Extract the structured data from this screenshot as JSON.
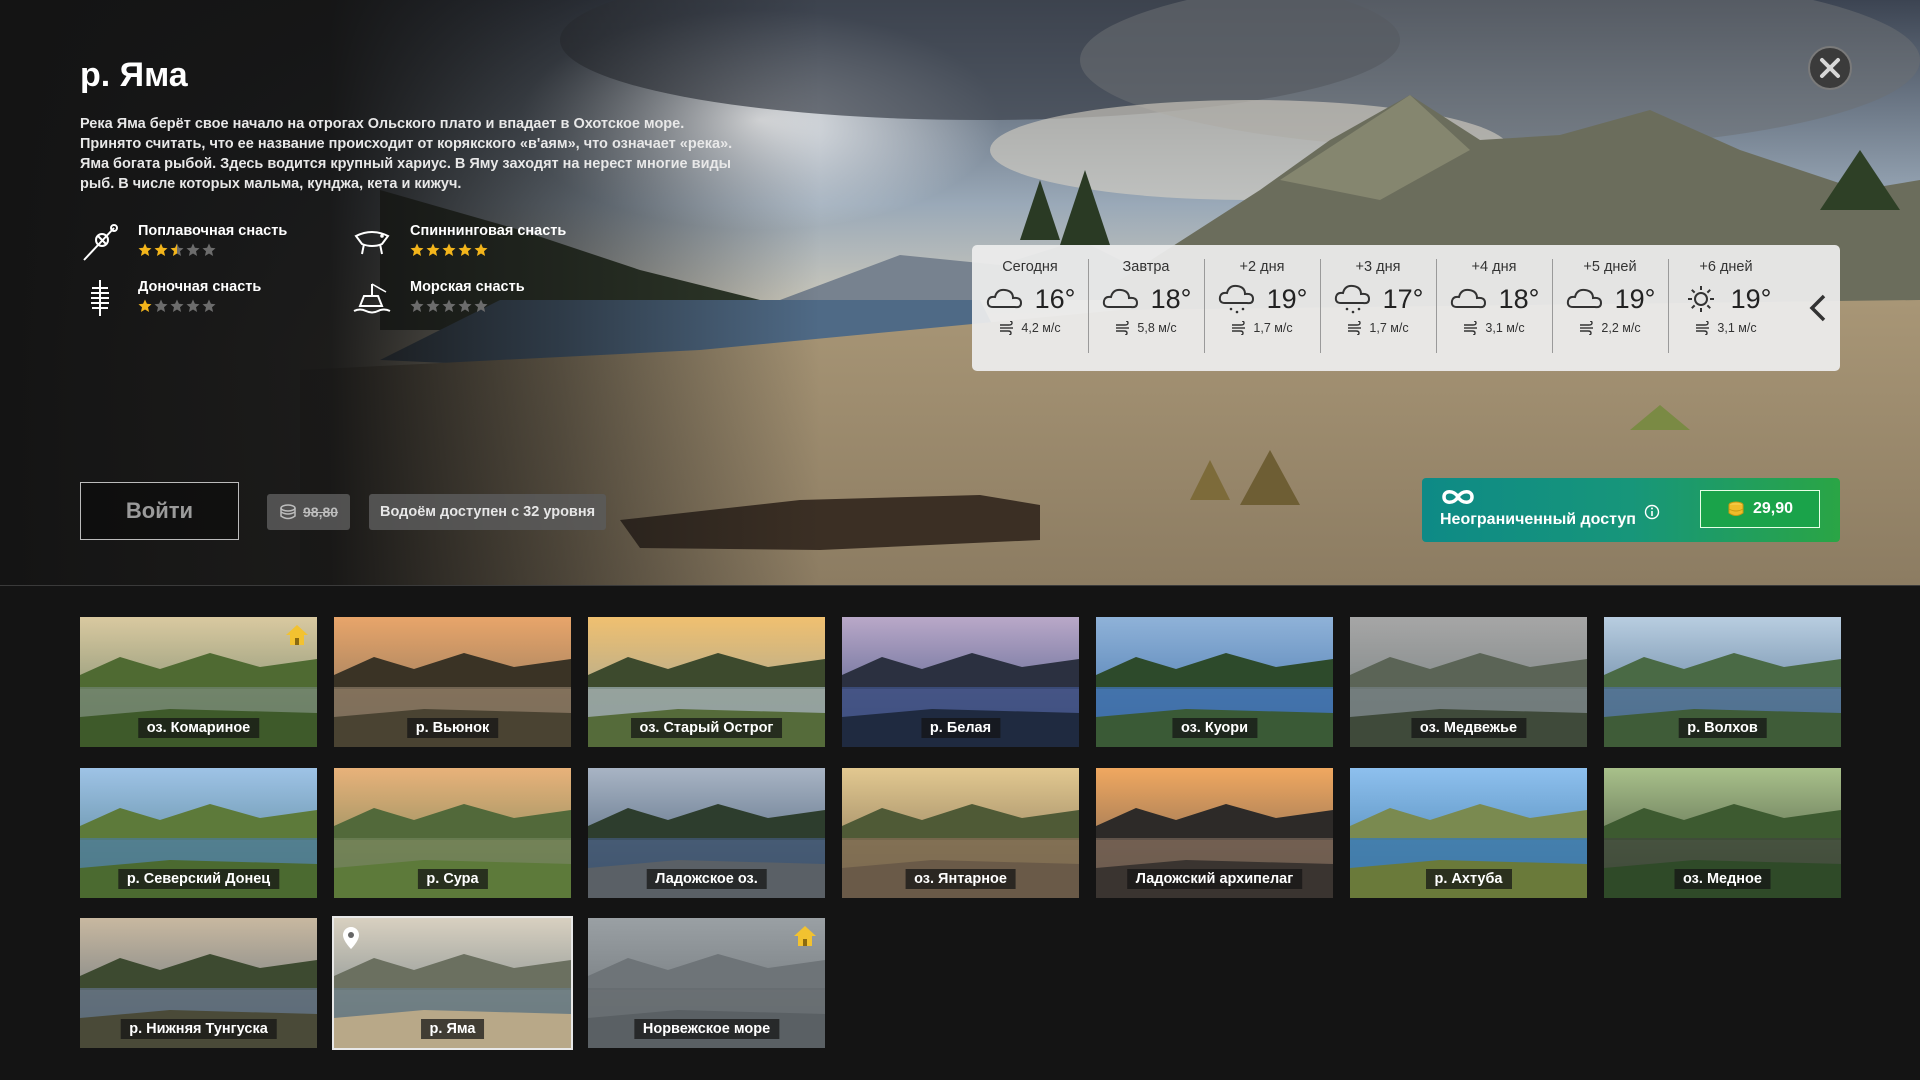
{
  "location": {
    "title": "р. Яма",
    "description": "Река Яма берёт свое начало на отрогах Ольского плато и впадает в Охотское море. Принято считать, что ее название происходит от корякского «в'аям», что означает «река». Яма богата рыбой. Здесь водится крупный хариус. В Яму заходят на нерест многие виды рыб. В числе которых мальма, кунджа, кета и кижуч."
  },
  "gear": [
    {
      "name": "Поплавочная снасть",
      "icon": "float-rod-icon",
      "rating": 2.5
    },
    {
      "name": "Спиннинговая снасть",
      "icon": "spinning-lure-icon",
      "rating": 5
    },
    {
      "name": "Доночная снасть",
      "icon": "feeder-icon",
      "rating": 1
    },
    {
      "name": "Морская снасть",
      "icon": "sea-fishing-icon",
      "rating": 0
    }
  ],
  "actions": {
    "enter_label": "Войти",
    "old_price": "98,80",
    "level_note": "Водоём доступен с 32 уровня"
  },
  "weather": [
    {
      "label": "Сегодня",
      "temp": "16°",
      "wind": "4,2 м/с",
      "icon": "cloud-icon"
    },
    {
      "label": "Завтра",
      "temp": "18°",
      "wind": "5,8 м/с",
      "icon": "cloud-icon"
    },
    {
      "label": "+2 дня",
      "temp": "19°",
      "wind": "1,7 м/с",
      "icon": "cloud-rain-icon"
    },
    {
      "label": "+3 дня",
      "temp": "17°",
      "wind": "1,7 м/с",
      "icon": "cloud-rain-icon"
    },
    {
      "label": "+4 дня",
      "temp": "18°",
      "wind": "3,1 м/с",
      "icon": "cloud-icon"
    },
    {
      "label": "+5 дней",
      "temp": "19°",
      "wind": "2,2 м/с",
      "icon": "cloud-icon"
    },
    {
      "label": "+6 дней",
      "temp": "19°",
      "wind": "3,1 м/с",
      "icon": "sun-icon"
    }
  ],
  "unlimited": {
    "label": "Неограниченный доступ",
    "price": "29,90"
  },
  "locations": [
    {
      "name": "оз. Комариное",
      "home": true,
      "sky": "#d9c9a0",
      "hill": "#4f6a32",
      "ground": "#3e5a2a",
      "water": "#6a7f66"
    },
    {
      "name": "р. Вьюнок",
      "sky": "#e8a56a",
      "hill": "#3a3325",
      "ground": "#4a4332",
      "water": "#7b6d5a"
    },
    {
      "name": "оз. Старый Острог",
      "sky": "#f0c070",
      "hill": "#3d4a2d",
      "ground": "#556b3a",
      "water": "#8fa0a0"
    },
    {
      "name": "р. Белая",
      "sky": "#b9a8c8",
      "hill": "#2b3040",
      "ground": "#1f2a40",
      "water": "#3d4f80"
    },
    {
      "name": "оз. Куори",
      "sky": "#8fb2d8",
      "hill": "#2d4a2b",
      "ground": "#3a5a36",
      "water": "#3e6fa8"
    },
    {
      "name": "оз. Медвежье",
      "sky": "#a6a6a6",
      "hill": "#5b6456",
      "ground": "#3f4a3a",
      "water": "#707a7a"
    },
    {
      "name": "р. Волхов",
      "sky": "#b8cde0",
      "hill": "#4a6a45",
      "ground": "#3f5c38",
      "water": "#4d6e8e"
    },
    {
      "name": "р. Северский Донец",
      "sky": "#9ec3e6",
      "hill": "#5d7a3a",
      "ground": "#4b6a30",
      "water": "#4d7a8a"
    },
    {
      "name": "р. Сура",
      "sky": "#e8b27a",
      "hill": "#52693a",
      "ground": "#5d7a3a",
      "water": "#6b7f55"
    },
    {
      "name": "Ладожское оз.",
      "sky": "#a8b4c4",
      "hill": "#2d3d2d",
      "ground": "#5a6066",
      "water": "#3f556e"
    },
    {
      "name": "оз. Янтарное",
      "sky": "#e2c890",
      "hill": "#4f5a36",
      "ground": "#6a5a48",
      "water": "#7b6a50"
    },
    {
      "name": "Ладожский архипелаг",
      "sky": "#f0a860",
      "hill": "#2d2a28",
      "ground": "#3a3430",
      "water": "#6a5a50"
    },
    {
      "name": "р. Ахтуба",
      "sky": "#8ec0ee",
      "hill": "#7a8a50",
      "ground": "#6a7a3a",
      "water": "#3f7aa8"
    },
    {
      "name": "оз. Медное",
      "sky": "#a8c08a",
      "hill": "#3d5a30",
      "ground": "#2f4a28",
      "water": "#3f4a3a"
    },
    {
      "name": "р. Нижняя Тунгуска",
      "sky": "#c8b8a0",
      "hill": "#3d4a30",
      "ground": "#4a4a38",
      "water": "#5a6a78"
    },
    {
      "name": "р. Яма",
      "selected": true,
      "pin": true,
      "sky": "#d8d0c0",
      "hill": "#6b7060",
      "ground": "#b8a888",
      "water": "#6a7a80"
    },
    {
      "name": "Норвежское море",
      "home": true,
      "sky": "#9aa0a4",
      "hill": "#6e7478",
      "ground": "#5a6064",
      "water": "#666c70"
    }
  ],
  "colors": {
    "star_gold": "#f3b51b",
    "star_empty": "#6c6c6c",
    "unlimited_start": "#0e8a86",
    "unlimited_end": "#2aa545"
  }
}
